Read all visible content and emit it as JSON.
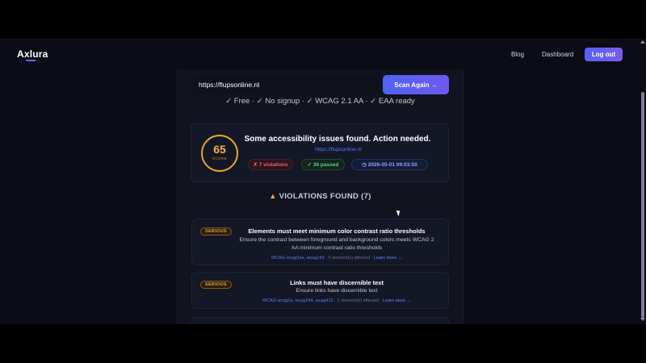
{
  "nav": {
    "logo": "Axlura",
    "links": [
      "Blog",
      "Dashboard"
    ],
    "logout_label": "Log out"
  },
  "scan": {
    "url_value": "https://flupsonline.nl",
    "button_label": "Scan Again →",
    "features": "✓ Free  ·  ✓ No signup  ·  ✓ WCAG 2.1 AA  ·  ✓ EAA ready"
  },
  "result": {
    "score": "65",
    "score_label": "SCORE",
    "title": "Some accessibility issues found. Action needed.",
    "url": "https://flupsonline.nl",
    "violations_badge": "✗ 7 violations",
    "passed_badge": "✓ 36 passed",
    "timestamp": "2026-05-01 09:03:50",
    "colors": {
      "score": "#f3b33d",
      "violations": "#ff5b6b",
      "passed": "#51d48a",
      "accent": "#5b6cff"
    }
  },
  "violations_heading": "VIOLATIONS FOUND (7)",
  "violations": [
    {
      "severity": "SERIOUS",
      "title": "Elements must meet minimum color contrast ratio thresholds",
      "desc_line1": "Ensure the contrast between foreground and background colors meets WCAG 2",
      "desc_line2": "AA minimum contrast ratio thresholds",
      "tags": "WCAG wcag2aa, wcag143",
      "affected": "5 element(s) affected",
      "learn_more": "Learn more →"
    },
    {
      "severity": "SERIOUS",
      "title": "Links must have discernible text",
      "desc_line1": "Ensure links have discernible text",
      "tags": "WCAG wcag2a, wcag244, wcag412",
      "affected": "2 element(s) affected",
      "learn_more": "Learn more →"
    }
  ]
}
